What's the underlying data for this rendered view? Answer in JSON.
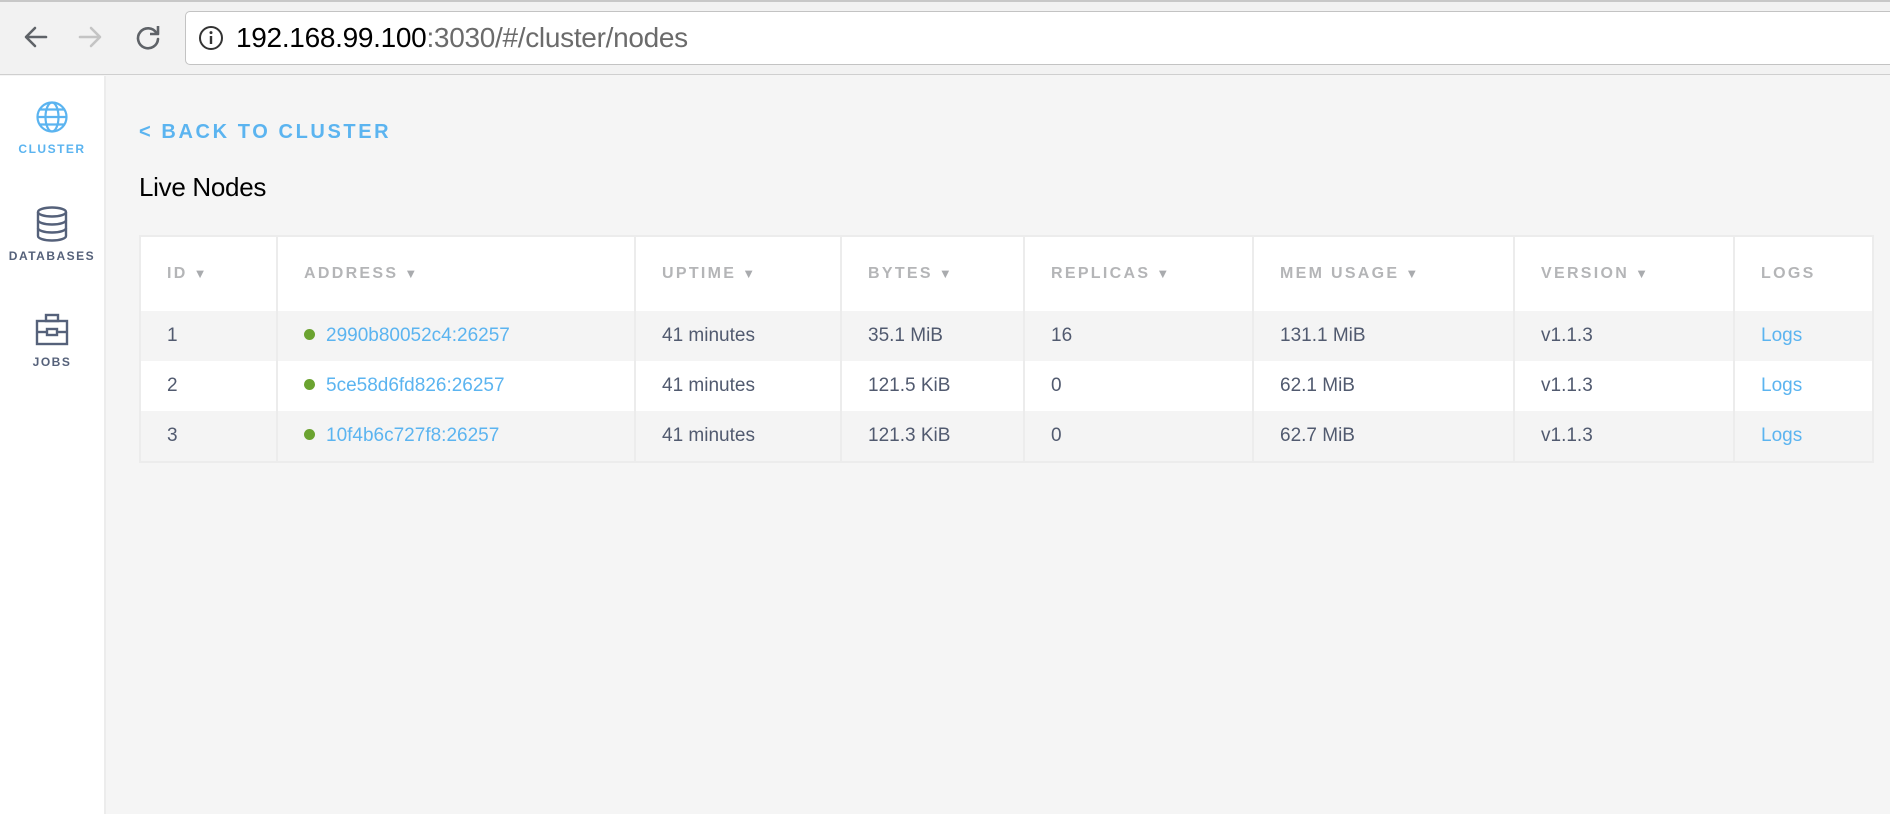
{
  "browser": {
    "url_host": "192.168.99.100",
    "url_rest": ":3030/#/cluster/nodes"
  },
  "sidebar": {
    "items": [
      {
        "label": "CLUSTER",
        "icon": "globe-icon",
        "active": true
      },
      {
        "label": "DATABASES",
        "icon": "database-icon",
        "active": false
      },
      {
        "label": "JOBS",
        "icon": "briefcase-icon",
        "active": false
      }
    ]
  },
  "main": {
    "back_link": "< BACK TO CLUSTER",
    "title": "Live Nodes",
    "sort_arrow": "▼",
    "columns": [
      {
        "label": "ID",
        "sortable": true
      },
      {
        "label": "ADDRESS",
        "sortable": true
      },
      {
        "label": "UPTIME",
        "sortable": true
      },
      {
        "label": "BYTES",
        "sortable": true
      },
      {
        "label": "REPLICAS",
        "sortable": true
      },
      {
        "label": "MEM USAGE",
        "sortable": true
      },
      {
        "label": "VERSION",
        "sortable": true
      },
      {
        "label": "LOGS",
        "sortable": false
      }
    ],
    "rows": [
      {
        "id": "1",
        "address": "2990b80052c4:26257",
        "status": "live",
        "uptime": "41 minutes",
        "bytes": "35.1 MiB",
        "replicas": "16",
        "mem_usage": "131.1 MiB",
        "version": "v1.1.3",
        "logs": "Logs"
      },
      {
        "id": "2",
        "address": "5ce58d6fd826:26257",
        "status": "live",
        "uptime": "41 minutes",
        "bytes": "121.5 KiB",
        "replicas": "0",
        "mem_usage": "62.1 MiB",
        "version": "v1.1.3",
        "logs": "Logs"
      },
      {
        "id": "3",
        "address": "10f4b6c727f8:26257",
        "status": "live",
        "uptime": "41 minutes",
        "bytes": "121.3 KiB",
        "replicas": "0",
        "mem_usage": "62.7 MiB",
        "version": "v1.1.3",
        "logs": "Logs"
      }
    ]
  },
  "colors": {
    "accent": "#5bb4f0",
    "status_live": "#6ba330",
    "text": "#515a6f",
    "header_text": "#b4b5b7"
  }
}
